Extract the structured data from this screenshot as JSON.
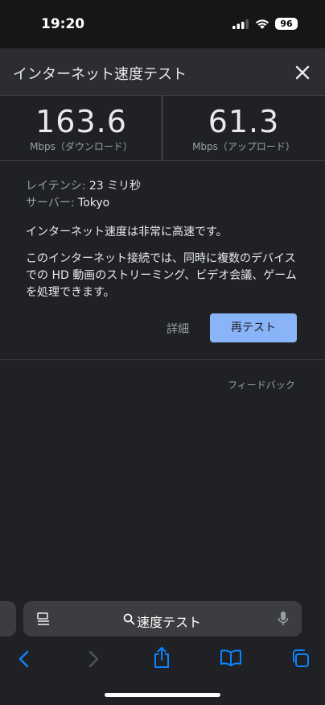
{
  "status_bar": {
    "time": "19:20",
    "battery": "96"
  },
  "dialog": {
    "title": "インターネット速度テスト",
    "download": {
      "value": "163.6",
      "unit": "Mbps（ダウンロード）"
    },
    "upload": {
      "value": "61.3",
      "unit": "Mbps（アップロード）"
    },
    "latency": {
      "label": "レイテンシ:",
      "value": "23 ミリ秒"
    },
    "server": {
      "label": "サーバー:",
      "value": "Tokyo"
    },
    "summary": "インターネット速度は非常に高速です。",
    "description": "このインターネット接続では、同時に複数のデバイスでの HD 動画のストリーミング、ビデオ会議、ゲームを処理できます。",
    "details_label": "詳細",
    "retest_label": "再テスト",
    "feedback_label": "フィードバック"
  },
  "browser": {
    "address_text": "速度テスト"
  },
  "colors": {
    "accent": "#8ab4f8",
    "ios_blue": "#0a84ff",
    "background": "#202124"
  }
}
